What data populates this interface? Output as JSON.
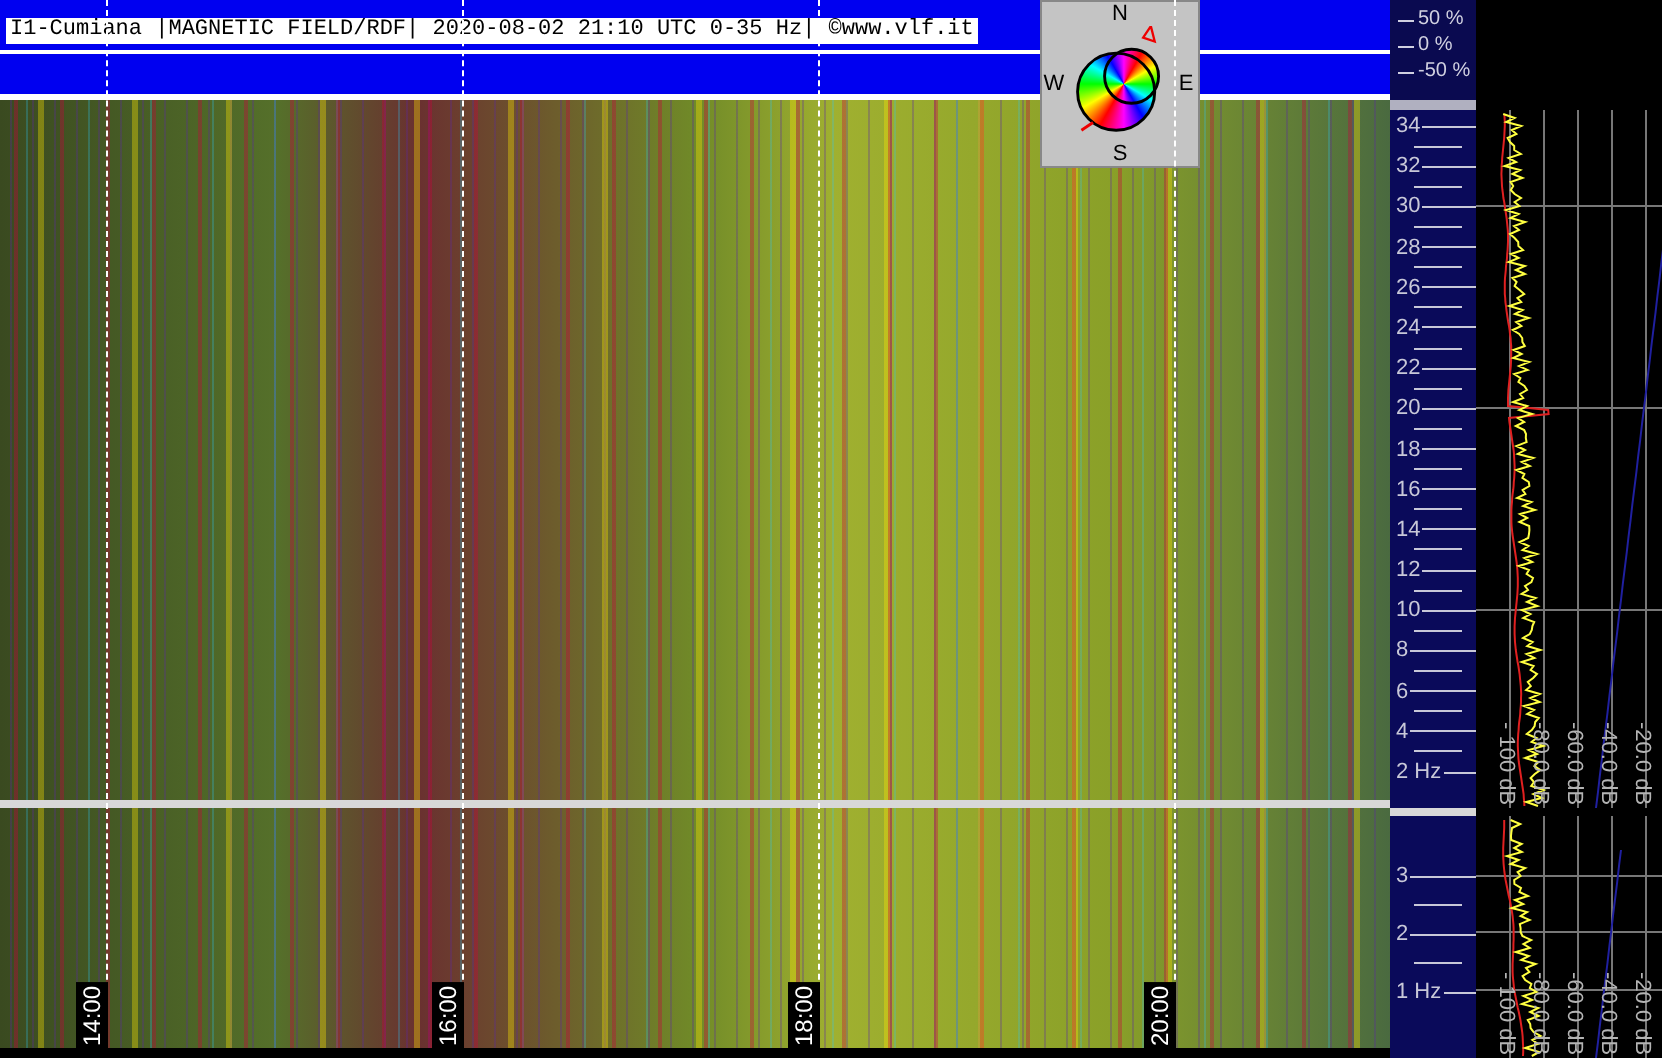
{
  "header": {
    "title": "I1-Cumiana |MAGNETIC FIELD/RDF| 2020-08-02 21:10 UTC 0-35 Hz| ©www.vlf.it",
    "amplitude_labels": [
      "50 %",
      "0 %",
      "-50 %"
    ]
  },
  "compass": {
    "labels": [
      "N",
      "W",
      "E",
      "S"
    ]
  },
  "upper_panel": {
    "freq_labels": [
      "34",
      "32",
      "30",
      "28",
      "26",
      "24",
      "22",
      "20",
      "18",
      "16",
      "14",
      "12",
      "10",
      "8",
      "6",
      "4",
      "2 Hz"
    ],
    "db_labels": [
      "- 100 dB",
      "-80.0 dB",
      "-60.0 dB",
      "-40.0 dB",
      "-20.0 dB"
    ]
  },
  "lower_panel": {
    "freq_labels": [
      "3",
      "2",
      "1 Hz"
    ],
    "db_labels": [
      "- 100 dB",
      "-80.0 dB",
      "-60.0 dB",
      "-40.0 dB",
      "-20.0 dB"
    ]
  },
  "time_labels": [
    "14:00",
    "16:00",
    "18:00",
    "20:00"
  ]
}
